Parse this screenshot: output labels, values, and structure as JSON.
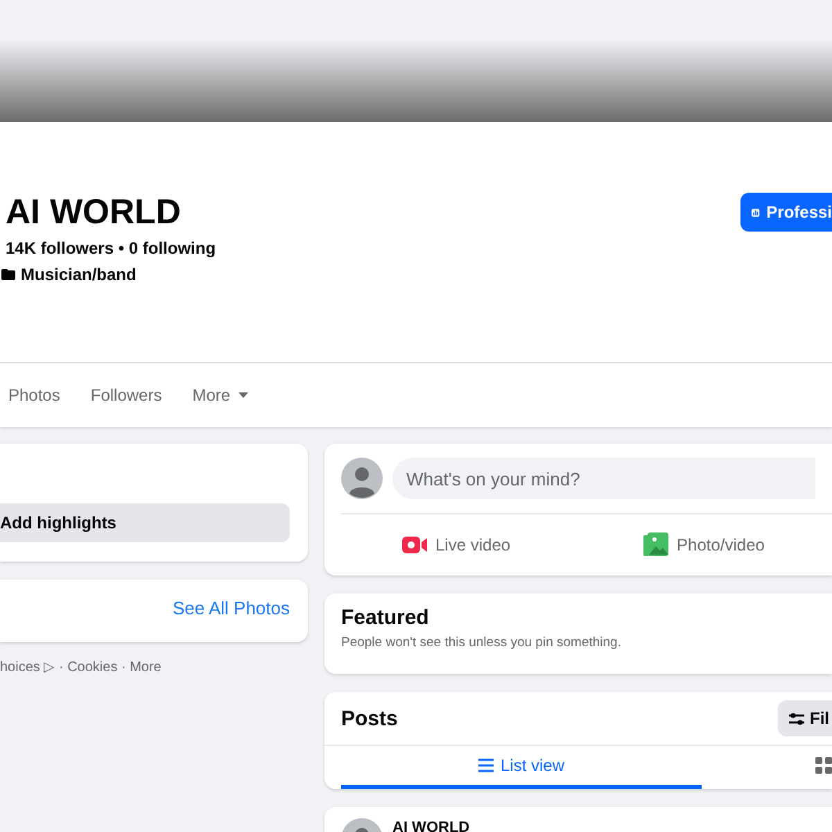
{
  "profile": {
    "name": "AI WORLD",
    "stats": "14K followers • 0 following",
    "category": "Musician/band",
    "action_button": "Professi"
  },
  "tabs": [
    {
      "label": "Photos",
      "selected": false
    },
    {
      "label": "Followers",
      "selected": false
    },
    {
      "label": "More",
      "selected": false,
      "kind": "dropdown"
    }
  ],
  "intro": {
    "button": "Add highlights"
  },
  "photos": {
    "link": "See All Photos"
  },
  "footer": "hoices ▷ · Cookies · More",
  "composer": {
    "placeholder": "What's on your mind?",
    "actions": [
      {
        "label": "Live video",
        "kind": "live"
      },
      {
        "label": "Photo/video",
        "kind": "photo"
      }
    ]
  },
  "featured": {
    "title": "Featured",
    "note": "People won't see this unless you pin something."
  },
  "posts": {
    "title": "Posts",
    "filter_button": "Fil",
    "views": [
      {
        "label": "List view",
        "kind": "list",
        "selected": true
      },
      {
        "kind": "grid",
        "selected": false
      }
    ]
  },
  "post": {
    "author": "AI WORLD"
  }
}
